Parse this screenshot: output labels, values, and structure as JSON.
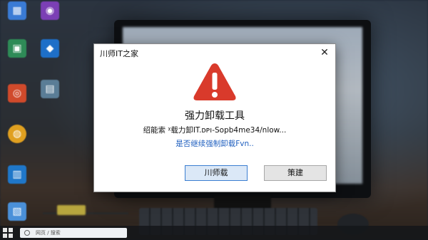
{
  "desktop": {
    "icons": [
      {
        "name": "desktop-icon-1",
        "label": "",
        "glyph": "▦",
        "color": "#3a7bd5"
      },
      {
        "name": "desktop-icon-2",
        "label": "",
        "glyph": "◉",
        "color": "#7b3fb5"
      },
      {
        "name": "desktop-icon-3",
        "label": "",
        "glyph": "▣",
        "color": "#2e8b57"
      },
      {
        "name": "desktop-icon-4",
        "label": "",
        "glyph": "◆",
        "color": "#1e6fc8"
      },
      {
        "name": "desktop-icon-5",
        "label": "",
        "glyph": "◎",
        "color": "#d04a2b"
      },
      {
        "name": "desktop-icon-6",
        "label": "",
        "glyph": "▤",
        "color": "#5a7d96"
      },
      {
        "name": "desktop-icon-7",
        "label": "",
        "glyph": "◍",
        "color": "#e0a020"
      },
      {
        "name": "desktop-icon-8",
        "label": "",
        "glyph": "▥",
        "color": "#1f77c9"
      },
      {
        "name": "desktop-icon-9",
        "label": "",
        "glyph": "▧",
        "color": "#4a90d9"
      }
    ]
  },
  "taskbar": {
    "search_text": "网页 / 搜索"
  },
  "dialog": {
    "title": "川师IT之家",
    "close_glyph": "✕",
    "heading": "强力卸载工具",
    "message": "绍能索 ᵡ载力卸IT.ᴅᴩı-Sopb4me34/nlow...",
    "prompt": "是否继续强制卸载Fvn..",
    "primary_button": "川师载",
    "secondary_button": "策建",
    "colors": {
      "warning_red": "#d93a2b",
      "prompt_blue": "#1f5fbf",
      "primary_border": "#3c7fd1"
    }
  }
}
